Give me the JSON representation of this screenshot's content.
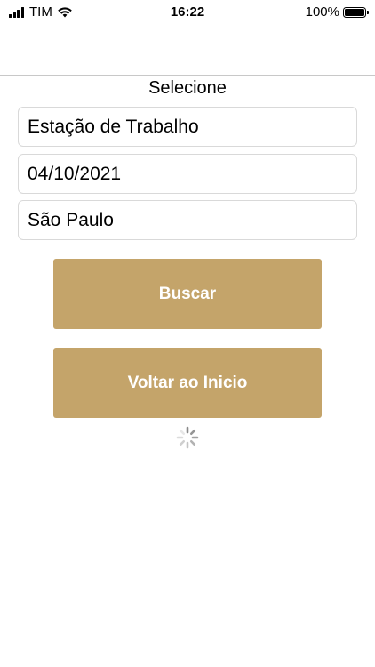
{
  "status_bar": {
    "carrier": "TIM",
    "time": "16:22",
    "battery_percent": "100%",
    "icons": [
      "signal-bars-icon",
      "wifi-icon",
      "battery-icon"
    ]
  },
  "page": {
    "title": "Selecione"
  },
  "fields": {
    "workstation": "Estação de Trabalho",
    "date": "04/10/2021",
    "city": "São Paulo"
  },
  "buttons": {
    "search": "Buscar",
    "back_home": "Voltar ao Inicio"
  },
  "loading_indicator": "spinner-icon",
  "colors": {
    "button_bg": "#c4a46a",
    "button_text": "#ffffff",
    "field_border": "#d9d9d9",
    "spinner": "#9e9e9e"
  }
}
